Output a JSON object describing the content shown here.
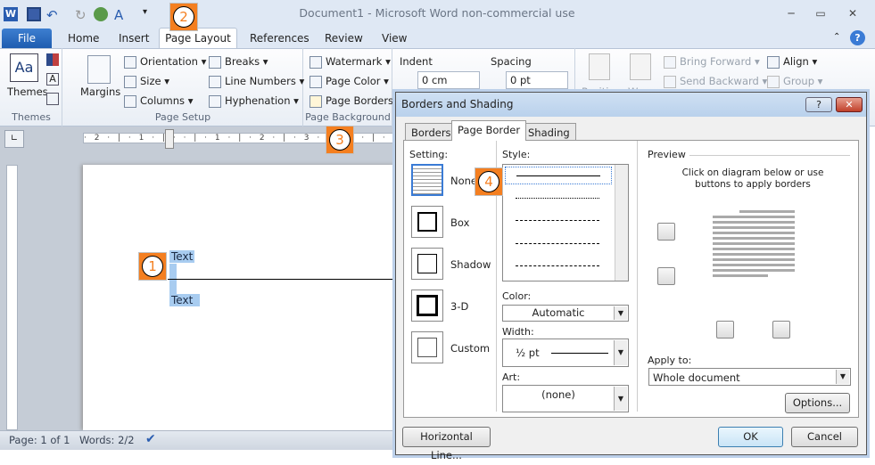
{
  "window": {
    "title": "Document1  -  Microsoft Word non-commercial use",
    "minimize": "─",
    "restore": "▭",
    "close": "✕"
  },
  "tabs": {
    "file": "File",
    "items": [
      "Home",
      "Insert",
      "Page Layout",
      "References",
      "Review",
      "View"
    ],
    "active": "Page Layout"
  },
  "ribbon": {
    "themes": {
      "themes": "Themes",
      "group": "Themes"
    },
    "page_setup": {
      "margins": "Margins",
      "orientation": "Orientation",
      "size": "Size",
      "columns": "Columns",
      "breaks": "Breaks",
      "line_numbers": "Line Numbers",
      "hyphenation": "Hyphenation",
      "group": "Page Setup"
    },
    "page_background": {
      "watermark": "Watermark",
      "page_color": "Page Color",
      "page_borders": "Page Borders",
      "group": "Page Background"
    },
    "paragraph": {
      "indent": "Indent",
      "indent_value": "0 cm",
      "spacing": "Spacing",
      "spacing_value": "0 pt"
    },
    "arrange": {
      "position": "Position",
      "wrap": "Wrap",
      "bring_forward": "Bring Forward",
      "send_backward": "Send Backward",
      "align": "Align",
      "group": "Group"
    }
  },
  "ruler": {
    "h": "· 2 · | · 1 · | ·   · | · 1 · | · 2 · | · 3 · | · 4 · | · 5 · | · 6 ·"
  },
  "document": {
    "text1": "Text",
    "text2": "Text"
  },
  "status": {
    "page": "Page: 1 of 1",
    "words": "Words: 2/2"
  },
  "callouts": [
    "1",
    "2",
    "3",
    "4"
  ],
  "dialog": {
    "title": "Borders and Shading",
    "help": "?",
    "close": "✕",
    "tabs": [
      "Borders",
      "Page Border",
      "Shading"
    ],
    "active_tab": "Page Border",
    "setting_label": "Setting:",
    "settings": [
      "None",
      "Box",
      "Shadow",
      "3-D",
      "Custom"
    ],
    "selected_setting": "None",
    "style_label": "Style:",
    "color_label": "Color:",
    "color_value": "Automatic",
    "width_label": "Width:",
    "width_value": "½ pt",
    "art_label": "Art:",
    "art_value": "(none)",
    "preview_label": "Preview",
    "preview_hint": "Click on diagram below or use buttons to apply borders",
    "apply_label": "Apply to:",
    "apply_value": "Whole document",
    "options": "Options...",
    "horizontal_line": "Horizontal Line...",
    "ok": "OK",
    "cancel": "Cancel"
  },
  "colors": {
    "accent_orange": "#f47f20",
    "file_tab": "#2a6cc0",
    "selection": "#a8ccf0"
  }
}
